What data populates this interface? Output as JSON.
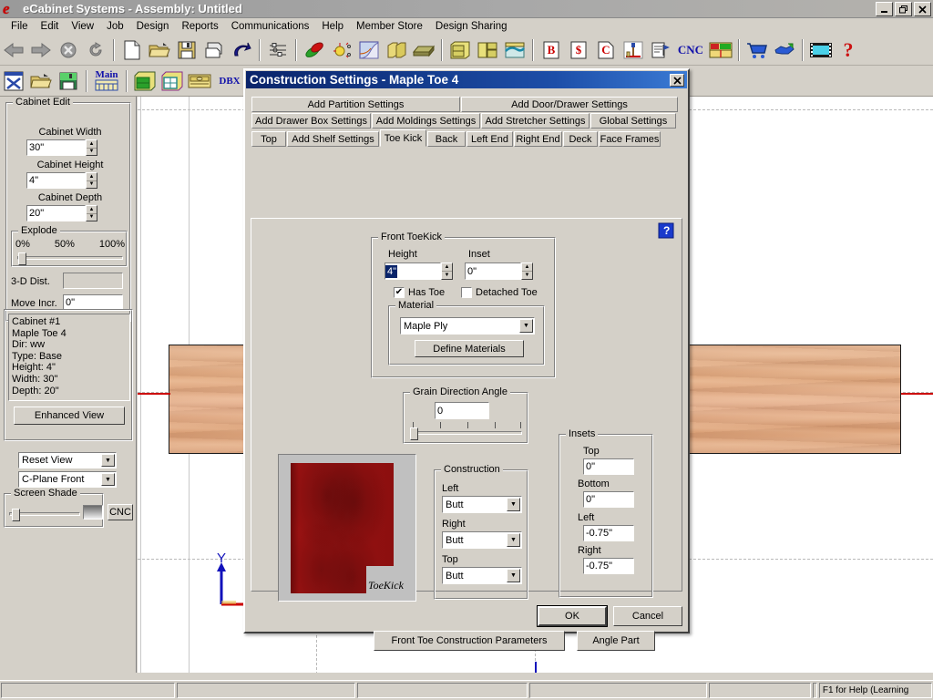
{
  "window": {
    "title": "eCabinet Systems - Assembly: Untitled",
    "logo_glyph": "e",
    "minimize": "_",
    "restore": "❐",
    "close": "✕"
  },
  "menubar": {
    "items": [
      {
        "label": "File"
      },
      {
        "label": "Edit"
      },
      {
        "label": "View"
      },
      {
        "label": "Job"
      },
      {
        "label": "Design"
      },
      {
        "label": "Reports"
      },
      {
        "label": "Communications"
      },
      {
        "label": "Help"
      },
      {
        "label": "Member Store"
      },
      {
        "label": "Design Sharing"
      }
    ]
  },
  "toolbar_row1": {
    "groups": [
      {
        "buttons": [
          {
            "icon": "back-arrow-icon"
          },
          {
            "icon": "forward-arrow-icon"
          },
          {
            "icon": "stop-icon"
          },
          {
            "icon": "refresh-icon"
          }
        ]
      },
      {
        "buttons": [
          {
            "icon": "new-document-icon"
          },
          {
            "icon": "open-folder-icon"
          },
          {
            "icon": "save-disk-icon"
          },
          {
            "icon": "print-icon"
          },
          {
            "icon": "undo-icon"
          }
        ]
      },
      {
        "buttons": [
          {
            "icon": "options-list-icon"
          }
        ]
      },
      {
        "buttons": [
          {
            "icon": "materials-icon"
          },
          {
            "icon": "hardware-icon"
          },
          {
            "icon": "edge-profile-icon"
          },
          {
            "icon": "moldings-icon"
          },
          {
            "icon": "panel-icon"
          }
        ]
      },
      {
        "buttons": [
          {
            "icon": "cabinet-icon"
          },
          {
            "icon": "cabinet-group-icon"
          },
          {
            "icon": "countertop-icon"
          }
        ]
      },
      {
        "buttons": [
          {
            "icon": "bill-report-icon",
            "text": "B"
          },
          {
            "icon": "cost-report-icon",
            "text": "$"
          },
          {
            "icon": "cutlist-report-icon",
            "text": "C"
          },
          {
            "icon": "machining-icon"
          },
          {
            "icon": "drawing-icon"
          },
          {
            "icon": "cnc-icon",
            "text": "CNC"
          },
          {
            "icon": "nesting-icon"
          }
        ]
      },
      {
        "buttons": [
          {
            "icon": "shopping-cart-icon"
          },
          {
            "icon": "handshake-icon"
          }
        ]
      },
      {
        "buttons": [
          {
            "icon": "video-icon"
          },
          {
            "icon": "help-question-icon",
            "text": "?"
          }
        ]
      }
    ]
  },
  "toolbar_row2": {
    "groups": [
      {
        "buttons": [
          {
            "icon": "new-job-icon"
          },
          {
            "icon": "open-job-icon"
          },
          {
            "icon": "save-job-icon"
          }
        ]
      },
      {
        "buttons": [
          {
            "icon": "main-library-icon",
            "text": "Main"
          }
        ]
      },
      {
        "buttons": [
          {
            "icon": "assembly-icon"
          },
          {
            "icon": "assembly-edit-icon"
          },
          {
            "icon": "drawer-icon"
          },
          {
            "icon": "dbx-icon",
            "text": "DBX"
          },
          {
            "icon": "ruler-icon"
          }
        ]
      }
    ]
  },
  "sidebar": {
    "cabinet_edit": {
      "title": "Cabinet Edit",
      "fields": [
        {
          "label": "Cabinet Width",
          "value": "30\"",
          "name": "cabinet-width"
        },
        {
          "label": "Cabinet Height",
          "value": "4\"",
          "name": "cabinet-height"
        },
        {
          "label": "Cabinet Depth",
          "value": "20\"",
          "name": "cabinet-depth"
        }
      ],
      "explode": {
        "title": "Explode",
        "ticks": [
          "0%",
          "50%",
          "100%"
        ],
        "value": 0
      },
      "dist_label": "3-D Dist.",
      "dist_value": "",
      "move_label": "Move Incr.",
      "move_value": "0\""
    },
    "cabinet_info": {
      "lines": [
        "Cabinet #1",
        "Maple Toe 4",
        "Dir: ww",
        "Type: Base",
        "Height: 4\"",
        "Width: 30\"",
        "Depth: 20\""
      ],
      "text": "Cabinet #1\nMaple Toe 4\nDir: ww\nType: Base\nHeight: 4\"\nWidth: 30\"\nDepth: 20\""
    },
    "enhanced_view_label": "Enhanced View",
    "view_select": "Reset View",
    "cplane_select": "C-Plane Front",
    "screen_shade": {
      "title": "Screen Shade",
      "value": 5
    },
    "cnc_label": "CNC"
  },
  "dialog": {
    "title": "Construction Settings - Maple Toe 4",
    "close_glyph": "✕",
    "help_icon": "help-properties-icon",
    "tabs_row1": [
      {
        "label": "Add Partition Settings",
        "active": false
      },
      {
        "label": "Add Door/Drawer Settings",
        "active": false
      }
    ],
    "tabs_row2": [
      {
        "label": "Add Drawer Box Settings",
        "active": false
      },
      {
        "label": "Add Moldings Settings",
        "active": false
      },
      {
        "label": "Add Stretcher Settings",
        "active": false
      },
      {
        "label": "Global Settings",
        "active": false
      }
    ],
    "tabs_row3": [
      {
        "label": "Top",
        "active": false
      },
      {
        "label": "Add Shelf Settings",
        "active": false
      },
      {
        "label": "Toe Kick",
        "active": true
      },
      {
        "label": "Back",
        "active": false
      },
      {
        "label": "Left End",
        "active": false
      },
      {
        "label": "Right End",
        "active": false
      },
      {
        "label": "Deck",
        "active": false
      },
      {
        "label": "Face Frames",
        "active": false
      }
    ],
    "front_toekick": {
      "title": "Front ToeKick",
      "height_label": "Height",
      "height_value": "4\"",
      "inset_label": "Inset",
      "inset_value": "0\"",
      "has_toe_label": "Has Toe",
      "has_toe_checked": true,
      "detached_toe_label": "Detached Toe",
      "detached_toe_checked": false,
      "material_title": "Material",
      "material_value": "Maple Ply",
      "define_materials_label": "Define Materials"
    },
    "grain": {
      "title": "Grain Direction Angle",
      "value": "0"
    },
    "preview": {
      "label": "ToeKick"
    },
    "construction": {
      "title": "Construction",
      "rows": [
        {
          "label": "Left",
          "value": "Butt"
        },
        {
          "label": "Right",
          "value": "Butt"
        },
        {
          "label": "Top",
          "value": "Butt"
        }
      ]
    },
    "insets": {
      "title": "Insets",
      "rows": [
        {
          "label": "Top",
          "value": "0\""
        },
        {
          "label": "Bottom",
          "value": "0\""
        },
        {
          "label": "Left",
          "value": "-0.75\""
        },
        {
          "label": "Right",
          "value": "-0.75\""
        }
      ]
    },
    "front_toe_params_label": "Front Toe Construction Parameters",
    "angle_part_label": "Angle Part",
    "ok_label": "OK",
    "cancel_label": "Cancel"
  },
  "viewport": {
    "axis_y_label": "Y"
  },
  "statusbar": {
    "cells": [
      "",
      "",
      "",
      "",
      "",
      "",
      ""
    ],
    "help_text": "F1 for Help (Learning"
  },
  "colors": {
    "titlebar_active": "#0a246a",
    "face": "#d4d0c8",
    "part_red": "#8c0f0f",
    "wood": "#e0ab83",
    "axis_y": "#1111bb",
    "axis_x": "#cc0000",
    "accent_cnc": "#0000cc"
  }
}
